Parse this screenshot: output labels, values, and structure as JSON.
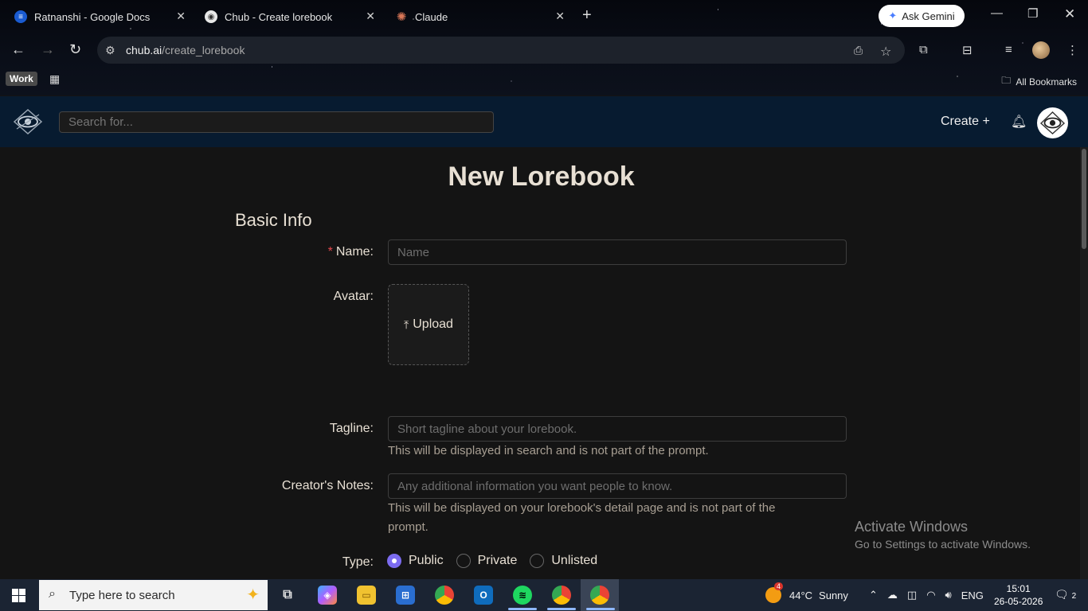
{
  "browser": {
    "tabs": [
      {
        "title": "Ratnanshi - Google Docs",
        "favicon": "google-docs-icon"
      },
      {
        "title": "Chub - Create lorebook",
        "favicon": "chub-icon",
        "active": true
      },
      {
        "title": "Claude",
        "favicon": "claude-icon"
      }
    ],
    "ask_gemini": "Ask Gemini",
    "url_host": "chub.ai",
    "url_path": "/create_lorebook",
    "bookmarks": {
      "work_label": "Work",
      "all_bookmarks": "All Bookmarks"
    }
  },
  "site": {
    "search_placeholder": "Search for...",
    "create_label": "Create +"
  },
  "page": {
    "title": "New Lorebook",
    "section": "Basic Info",
    "fields": {
      "name": {
        "label": "Name:",
        "required_mark": "*",
        "placeholder": "Name"
      },
      "avatar": {
        "label": "Avatar:",
        "upload_label": "Upload"
      },
      "tagline": {
        "label": "Tagline:",
        "placeholder": "Short tagline about your lorebook.",
        "help": "This will be displayed in search and is not part of the prompt."
      },
      "creators_notes": {
        "label": "Creator's Notes:",
        "placeholder": "Any additional information you want people to know.",
        "help": "This will be displayed on your lorebook's detail page and is not part of the prompt."
      },
      "type": {
        "label": "Type:",
        "options": [
          "Public",
          "Private",
          "Unlisted"
        ],
        "selected": "Public"
      }
    }
  },
  "watermark": {
    "line1": "Activate Windows",
    "line2": "Go to Settings to activate Windows."
  },
  "taskbar": {
    "search_placeholder": "Type here to search",
    "weather_badge": "4",
    "weather_temp": "44°C",
    "weather_cond": "Sunny",
    "language": "ENG",
    "time": "15:01",
    "date": "26-05-2026",
    "notif_count": "2"
  }
}
